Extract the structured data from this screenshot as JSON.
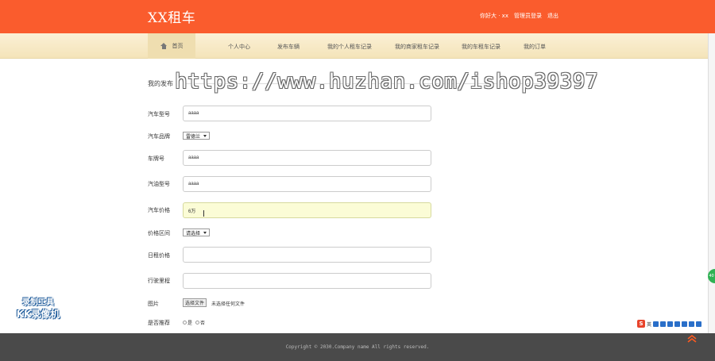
{
  "header": {
    "brand": "XX租车",
    "nav_right": [
      "你好大 · xx",
      "管理员登录",
      "退出"
    ]
  },
  "nav": {
    "home": "首页",
    "items": [
      "个人中心",
      "发布车辆",
      "我的个人租车记录",
      "我的商家租车记录",
      "我的车租车记录",
      "我的订单"
    ]
  },
  "watermark": "https://www.huzhan.com/ishop39397",
  "section_title": "我的发布",
  "form": {
    "model_label": "汽车型号",
    "model_value": "aaaa",
    "brand_label": "汽车品牌",
    "brand_value": "雷德兰",
    "plate_label": "车牌号",
    "plate_value": "aaaa",
    "engine_label": "汽油型号",
    "engine_value": "aaaa",
    "price_label": "汽车价格",
    "price_value": "6万",
    "range_label": "价格区间",
    "range_value": "请选择",
    "daily_label": "日租价格",
    "daily_value": "",
    "mileage_label": "行驶里程",
    "mileage_value": "",
    "image_label": "图片",
    "file_button": "选择文件",
    "file_none": "未选择任何文件",
    "recommend_label": "是否推荐",
    "recommend_yes": "是",
    "recommend_no": "否"
  },
  "footer": {
    "copyright": "Copyright © 2030.Company name All rights reserved."
  },
  "overlay": {
    "kk_line1": "录制工具",
    "kk_line2": "KK录像机",
    "ime_logo": "S",
    "ime_mode": "英",
    "side_widget": "40"
  },
  "colors": {
    "header_bg": "#fa5c2d",
    "nav_bg": "#f4e4b9",
    "footer_bg": "#4a4a4a",
    "active_input_bg": "#fbfcd6"
  }
}
